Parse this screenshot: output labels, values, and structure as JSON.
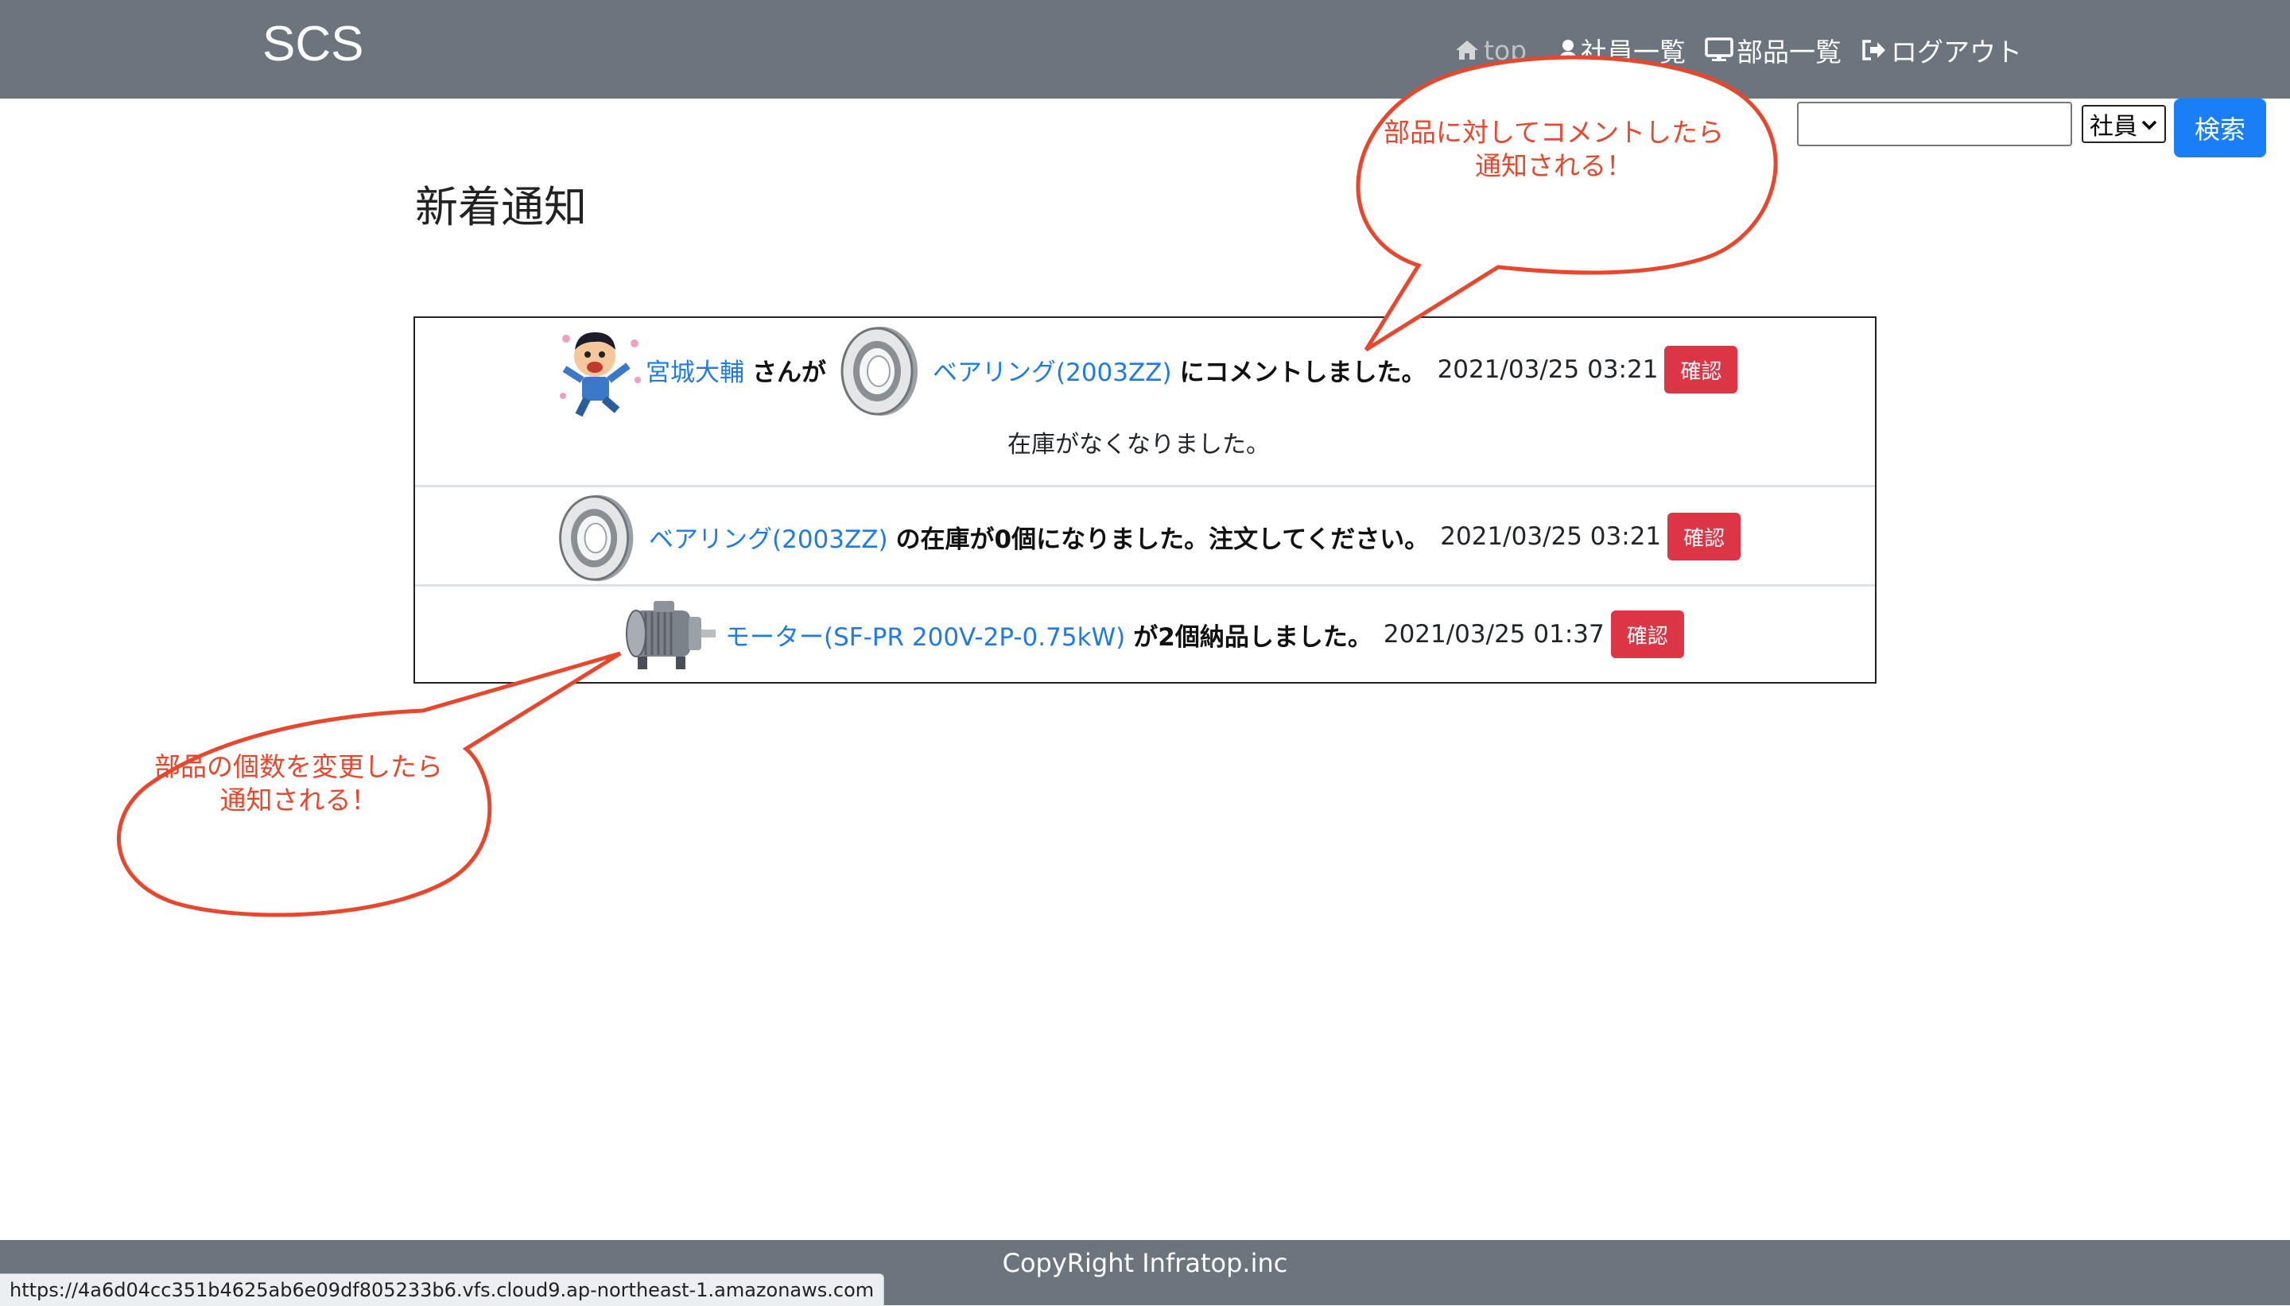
{
  "navbar": {
    "brand": "SCS",
    "links": [
      {
        "label": "top",
        "icon": "home-icon"
      },
      {
        "label": "社員一覧",
        "icon": "user-icon"
      },
      {
        "label": "部品一覧",
        "icon": "desktop-icon"
      },
      {
        "label": "ログアウト",
        "icon": "sign-out-icon"
      }
    ]
  },
  "search": {
    "input_value": "",
    "select_value": "社員",
    "button_label": "検索"
  },
  "page": {
    "title": "新着通知"
  },
  "notifications": [
    {
      "user": "宮城大輔",
      "text_mid": "さんが",
      "part_link": "ベアリング(2003ZZ)",
      "text_after": "にコメントしました。",
      "time": "2021/03/25 03:21",
      "button": "確認",
      "message": "在庫がなくなりました。"
    },
    {
      "part_link": "ベアリング(2003ZZ)",
      "text_after": "の在庫が0個になりました。注文してください。",
      "time": "2021/03/25 03:21",
      "button": "確認"
    },
    {
      "part_link": "モーター(SF-PR 200V-2P-0.75kW)",
      "text_after": "が2個納品しました。",
      "time": "2021/03/25 01:37",
      "button": "確認"
    }
  ],
  "annotations": [
    {
      "line1": "部品に対してコメントしたら",
      "line2": "通知される！"
    },
    {
      "line1": "部品の個数を変更したら",
      "line2": "通知される！"
    }
  ],
  "footer": {
    "copyright": "CopyRight Infratop.inc"
  },
  "status_bar": {
    "url": "https://4a6d04cc351b4625ab6e09df805233b6.vfs.cloud9.ap-northeast-1.amazonaws.com"
  },
  "colors": {
    "navbar": "#6c757d",
    "link": "#1f7be4",
    "danger": "#dc3545",
    "primary": "#1a7ef7",
    "annotation": "#e6472d"
  }
}
